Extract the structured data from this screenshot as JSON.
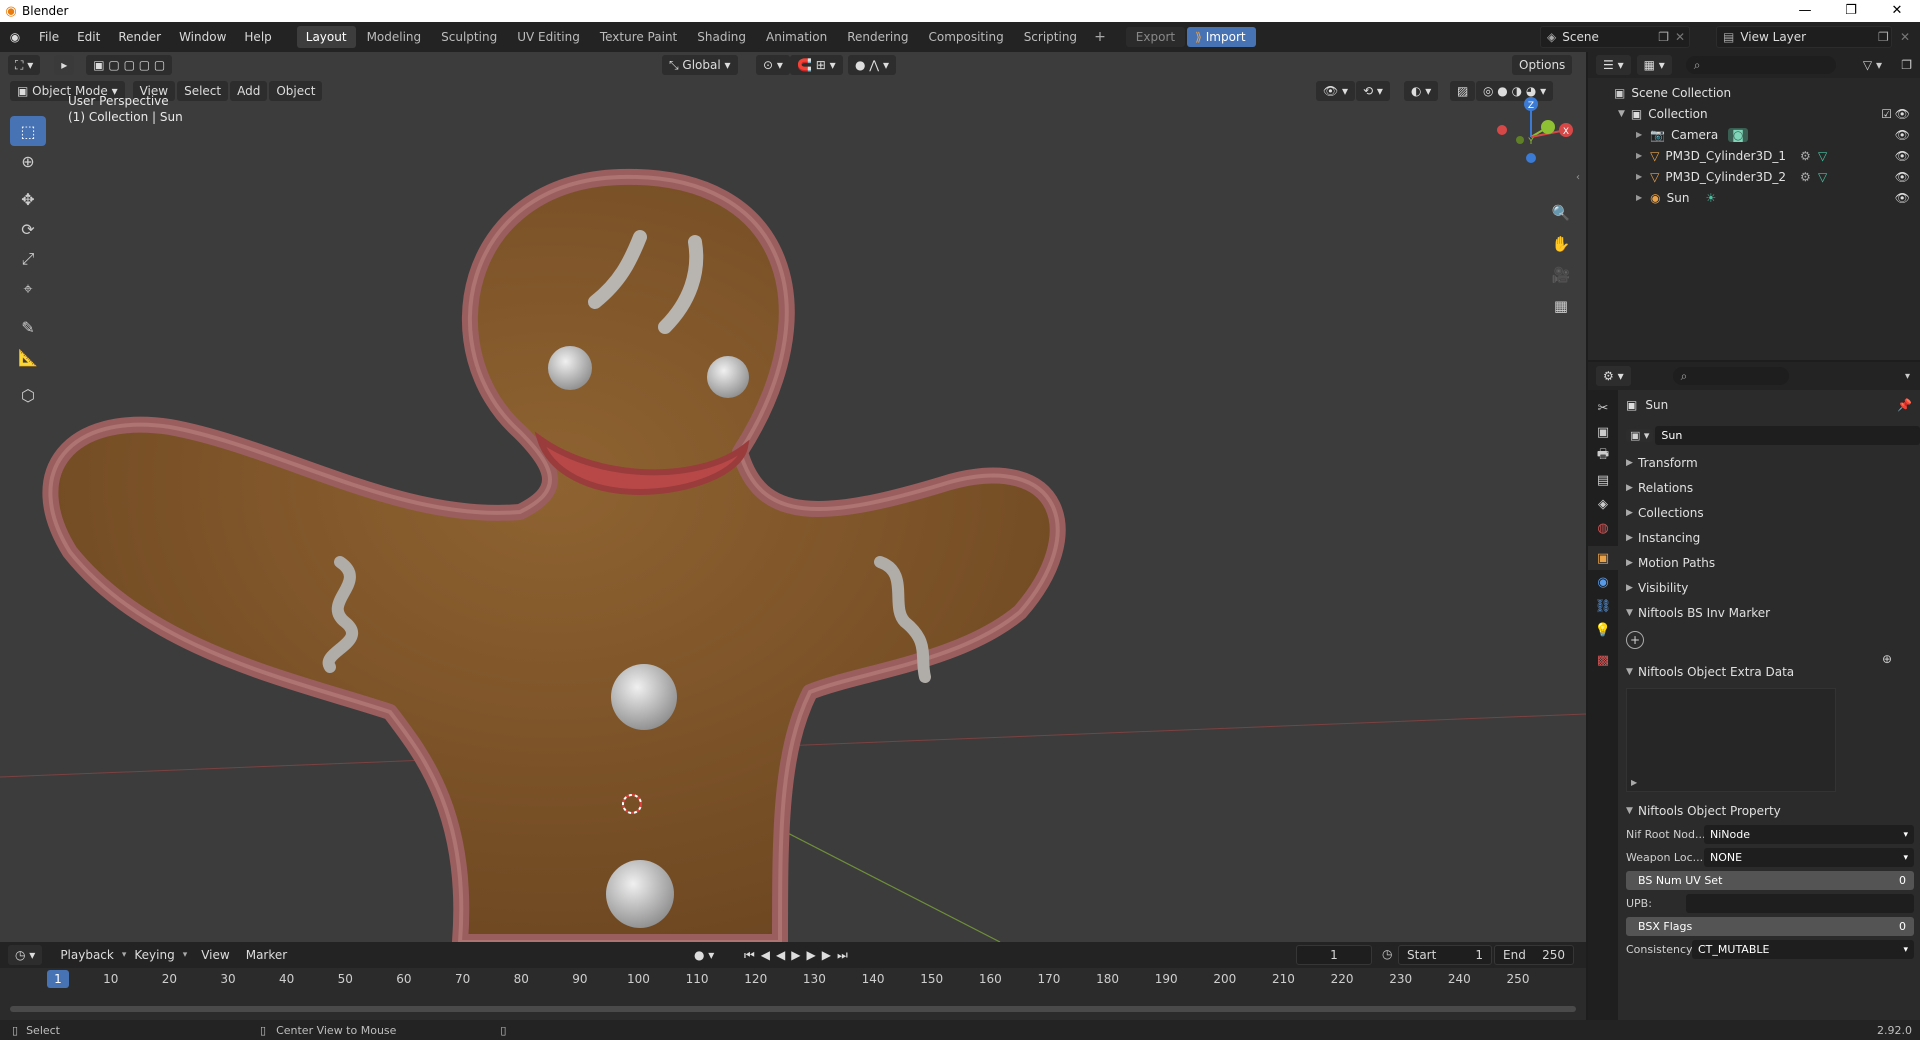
{
  "window": {
    "title": "Blender"
  },
  "menu": [
    "File",
    "Edit",
    "Render",
    "Window",
    "Help"
  ],
  "workspaces": [
    {
      "label": "Layout",
      "active": true
    },
    {
      "label": "Modeling"
    },
    {
      "label": "Sculpting"
    },
    {
      "label": "UV Editing"
    },
    {
      "label": "Texture Paint"
    },
    {
      "label": "Shading"
    },
    {
      "label": "Animation"
    },
    {
      "label": "Rendering"
    },
    {
      "label": "Compositing"
    },
    {
      "label": "Scripting"
    }
  ],
  "topbar": {
    "export_label": "Export",
    "import_label": "Import",
    "scene": "Scene",
    "view_layer": "View Layer"
  },
  "viewport": {
    "mode": "Object Mode",
    "menus": [
      "View",
      "Select",
      "Add",
      "Object"
    ],
    "orientation": "Global",
    "options_label": "Options",
    "info_line1": "User Perspective",
    "info_line2": "(1) Collection | Sun"
  },
  "gizmo": {
    "z": "Z",
    "y": "Y",
    "x": "X"
  },
  "timeline": {
    "menus": [
      "Playback",
      "Keying",
      "View",
      "Marker"
    ],
    "current_frame": "1",
    "start_label": "Start",
    "start": "1",
    "end_label": "End",
    "end": "250",
    "ticks": [
      "1",
      "10",
      "20",
      "30",
      "40",
      "50",
      "60",
      "70",
      "80",
      "90",
      "100",
      "110",
      "120",
      "130",
      "140",
      "150",
      "160",
      "170",
      "180",
      "190",
      "200",
      "210",
      "220",
      "230",
      "240",
      "250"
    ]
  },
  "status": {
    "left": "Select",
    "middle": "Center View to Mouse",
    "version": "2.92.0"
  },
  "outliner": {
    "scene_collection": "Scene Collection",
    "collection": "Collection",
    "items": [
      {
        "name": "Camera",
        "icon": "camera-icon"
      },
      {
        "name": "PM3D_Cylinder3D_1",
        "icon": "mesh-icon"
      },
      {
        "name": "PM3D_Cylinder3D_2",
        "icon": "mesh-icon"
      },
      {
        "name": "Sun",
        "icon": "light-icon"
      }
    ]
  },
  "properties": {
    "object_name": "Sun",
    "name_field": "Sun",
    "panels": [
      "Transform",
      "Relations",
      "Collections",
      "Instancing",
      "Motion Paths",
      "Visibility"
    ],
    "niftools_inv_marker": "Niftools BS Inv Marker",
    "niftools_extra_data": "Niftools Object Extra Data",
    "niftools_property": "Niftools Object Property",
    "rows": {
      "nif_root_label": "Nif Root Nod...",
      "nif_root_value": "NiNode",
      "weapon_label": "Weapon Loc...",
      "weapon_value": "NONE",
      "bs_num_uv_label": "BS Num UV Set",
      "bs_num_uv_value": "0",
      "upb_label": "UPB:",
      "bsx_label": "BSX Flags",
      "bsx_value": "0",
      "consistency_label": "Consistency...",
      "consistency_value": "CT_MUTABLE"
    }
  },
  "colors": {
    "accent": "#4772b3",
    "viewport_bg": "#3c3c3c",
    "cookie": "#8a5a2a",
    "frosting": "#9a5e5e"
  }
}
